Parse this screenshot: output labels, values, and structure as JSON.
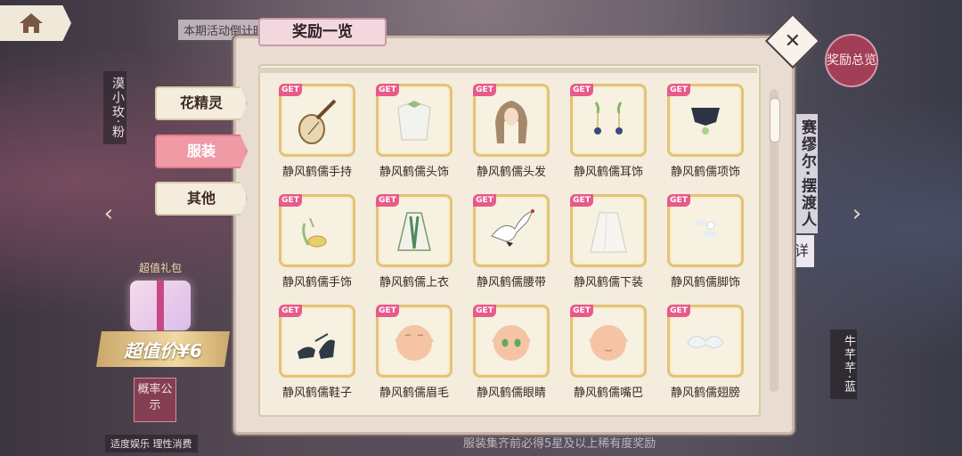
{
  "header": {
    "countdown_text": "本期活动倒计时",
    "reward_overview": "奖励总览"
  },
  "background": {
    "left_name": "漠小玫·粉",
    "right_name": "赛缪尔·摆渡人",
    "detail_tag": "详",
    "right_name2": "牛芊芊·蓝",
    "gift_label": "超值礼包",
    "price_text": "超值价¥6",
    "prob_text": "概率公示",
    "footer_left": "适度娱乐  理性消费",
    "footer_notice": "服装集齐前必得5星及以上稀有度奖励"
  },
  "modal": {
    "title": "奖励一览",
    "close_icon": "close-icon"
  },
  "tabs": [
    {
      "label": "花精灵",
      "active": false
    },
    {
      "label": "服装",
      "active": true
    },
    {
      "label": "其他",
      "active": false
    }
  ],
  "get_badge": "GET",
  "items": [
    {
      "name": "静风鹤儒手持",
      "icon": "pipa-icon"
    },
    {
      "name": "静风鹤儒头饰",
      "icon": "headpiece-icon"
    },
    {
      "name": "静风鹤儒头发",
      "icon": "hair-icon"
    },
    {
      "name": "静风鹤儒耳饰",
      "icon": "earring-icon"
    },
    {
      "name": "静风鹤儒项饰",
      "icon": "necklace-icon"
    },
    {
      "name": "静风鹤儒手饰",
      "icon": "bracelet-icon"
    },
    {
      "name": "静风鹤儒上衣",
      "icon": "top-icon"
    },
    {
      "name": "静风鹤儒腰带",
      "icon": "crane-icon"
    },
    {
      "name": "静风鹤儒下装",
      "icon": "skirt-icon"
    },
    {
      "name": "静风鹤儒脚饰",
      "icon": "anklet-icon"
    },
    {
      "name": "静风鹤儒鞋子",
      "icon": "shoes-icon"
    },
    {
      "name": "静风鹤儒眉毛",
      "icon": "eyebrow-icon"
    },
    {
      "name": "静风鹤儒眼睛",
      "icon": "eyes-icon"
    },
    {
      "name": "静风鹤儒嘴巴",
      "icon": "mouth-icon"
    },
    {
      "name": "静风鹤儒翅膀",
      "icon": "wings-icon"
    }
  ]
}
